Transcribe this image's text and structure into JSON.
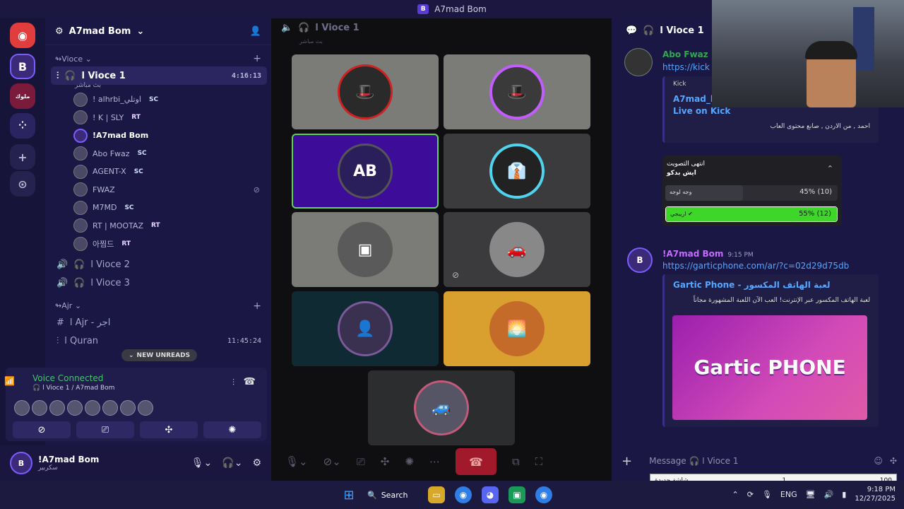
{
  "window": {
    "title": "A7mad Bom",
    "icon": "B"
  },
  "rail": {
    "servers": [
      {
        "name": "discord-home",
        "glyph": "◉",
        "color": "#e23d3d"
      },
      {
        "name": "ab-server",
        "glyph": "B",
        "color": "#3b2a78"
      },
      {
        "name": "red-server",
        "glyph": "ملوك",
        "color": "#7b1a3b"
      },
      {
        "name": "multi-server",
        "glyph": "⁘",
        "color": "#2a2560"
      },
      {
        "name": "add-server",
        "glyph": "+",
        "color": "#26224f"
      },
      {
        "name": "discover",
        "glyph": "⊙",
        "color": "#26224f"
      }
    ]
  },
  "sidebar": {
    "server_name": "A7mad Bom",
    "categories": [
      {
        "name": "Vioce",
        "prefix": "↬"
      },
      {
        "name": "Ajr",
        "prefix": "↬"
      }
    ],
    "active_channel": {
      "name": "Vioce 1",
      "time": "4:16:13",
      "status": "بث مباشر"
    },
    "users": [
      {
        "name": "! alhrbi_اوتلي",
        "badge": "SC",
        "type": "sc"
      },
      {
        "name": "! K | SLY",
        "badge": "RT",
        "type": "rt"
      },
      {
        "name": "!A7mad Bom",
        "badge": "",
        "type": ""
      },
      {
        "name": "Abo Fwaz",
        "badge": "SC",
        "type": "sc"
      },
      {
        "name": "AGENT-X",
        "badge": "SC",
        "type": "sc"
      },
      {
        "name": "FWAZ",
        "badge": "",
        "type": ""
      },
      {
        "name": "M7MD",
        "badge": "SC",
        "type": "sc"
      },
      {
        "name": "RT | MOOTAZ",
        "badge": "RT",
        "type": "rt"
      },
      {
        "name": "아찜드",
        "badge": "RT",
        "type": "rt"
      }
    ],
    "channels_after": [
      {
        "name": "Vioce 2"
      },
      {
        "name": "Vioce 3"
      }
    ],
    "ajr_channels": [
      {
        "name": "Ajr - اجر",
        "time": ""
      },
      {
        "name": "Quran",
        "time": "11:45:24"
      }
    ],
    "new_unreads": "NEW UNREADS"
  },
  "voice_panel": {
    "title": "Voice Connected",
    "subtitle": "Vioce 1 / A7mad Bom"
  },
  "user_panel": {
    "name": "!A7mad Bom",
    "status": "سكربير"
  },
  "stage": {
    "channel_name": "Vioce 1",
    "sub": "بث مباشر"
  },
  "chat": {
    "channel_name": "Vioce 1",
    "msg1": {
      "author": "Abo Fwaz",
      "link": "https://kick",
      "embed_provider": "Kick",
      "embed_title": "A7mad_b\nLive on Kick",
      "embed_desc": "احمد , من الاردن , صانع محتوى العاب"
    },
    "poll": {
      "status": "انتهى التصويت",
      "question": "ايش بدكو",
      "options": [
        {
          "label": "وجه لوجه",
          "pct": "45% (10)",
          "fraction": 0.45,
          "winner": false
        },
        {
          "label": "اريبجي",
          "pct": "55% (12)",
          "fraction": 1.0,
          "winner": true
        }
      ]
    },
    "msg2": {
      "author": "!A7mad Bom",
      "time": "9:15 PM",
      "link": "https://garticphone.com/ar/?c=02d29d75db",
      "embed_title": "Gartic Phone - لعبة الهاتف المكسور",
      "embed_desc": "لعبة الهاتف المكسور عبر الإنترنت! العب الآن اللعبة المشهورة مجاناً",
      "image_text": "Gartic PHONE"
    },
    "composer_placeholder": "Message",
    "composer_channel": "Vioce 1"
  },
  "taskbar": {
    "search": "Search",
    "lang": "ENG",
    "time": "9:18 PM",
    "date": "12/27/2025"
  },
  "overlay": {
    "left": "شاشة جديدة",
    "mid": "1",
    "right": "100"
  }
}
